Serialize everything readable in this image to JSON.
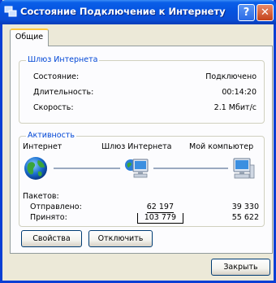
{
  "window": {
    "title": "Состояние Подключение к Интернету"
  },
  "titlebar": {
    "help_glyph": "?",
    "close_glyph": "✕"
  },
  "tabs": [
    {
      "label": "Общие",
      "active": true
    }
  ],
  "gateway": {
    "title": "Шлюз Интернета",
    "rows": [
      {
        "label": "Состояние:",
        "value": "Подключено"
      },
      {
        "label": "Длительность:",
        "value": "00:14:20"
      },
      {
        "label": "Скорость:",
        "value": "2.1 Мбит/с"
      }
    ]
  },
  "activity": {
    "title": "Активность",
    "nodes": {
      "internet": "Интернет",
      "gateway": "Шлюз Интернета",
      "computer": "Мой компьютер"
    },
    "packets_label": "Пакетов:",
    "sent_label": "Отправлено:",
    "received_label": "Принято:",
    "gateway_sent": "62 197",
    "gateway_received": "103 779",
    "computer_sent": "39 330",
    "computer_received": "55 622"
  },
  "buttons": {
    "properties": "Свойства",
    "disconnect": "Отключить",
    "close": "Закрыть"
  },
  "colors": {
    "title_blue": "#0553e0",
    "group_title": "#0046d5",
    "tab_highlight": "#ffc83c"
  },
  "icons": {
    "app": "network-connection-icon",
    "internet": "globe-icon",
    "gateway": "gateway-computer-icon",
    "computer": "computer-icon"
  }
}
